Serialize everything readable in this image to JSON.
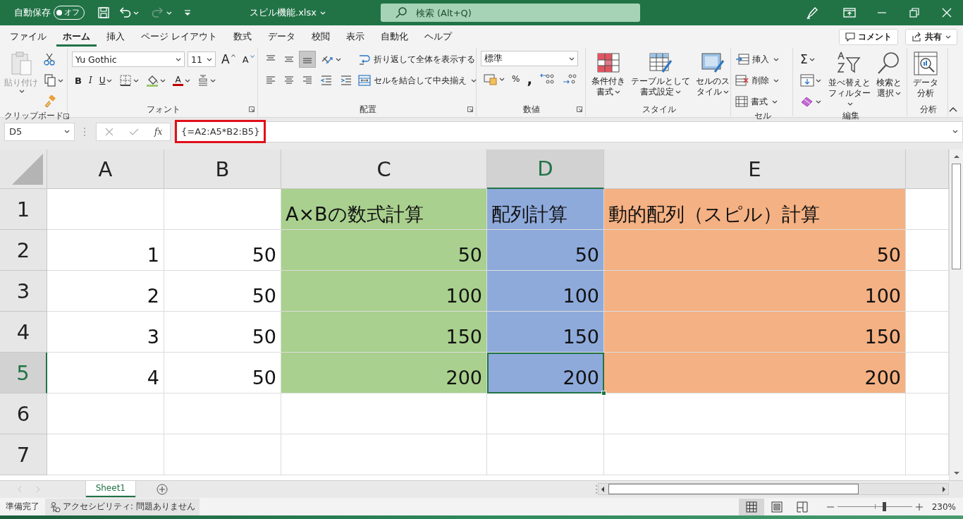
{
  "title_bar": {
    "autosave_label": "自動保存",
    "autosave_toggle": {
      "label": "オフ",
      "on": false
    },
    "redo_disabled": true,
    "filename": "スピル機能.xlsx",
    "search_placeholder": "検索 (Alt+Q)"
  },
  "menu_tabs": [
    {
      "label": "ファイル",
      "selected": false
    },
    {
      "label": "ホーム",
      "selected": true
    },
    {
      "label": "挿入",
      "selected": false
    },
    {
      "label": "ページ レイアウト",
      "selected": false
    },
    {
      "label": "数式",
      "selected": false
    },
    {
      "label": "データ",
      "selected": false
    },
    {
      "label": "校閲",
      "selected": false
    },
    {
      "label": "表示",
      "selected": false
    },
    {
      "label": "自動化",
      "selected": false
    },
    {
      "label": "ヘルプ",
      "selected": false
    }
  ],
  "comment_button": "コメント",
  "share_button": "共有",
  "ribbon": [
    {
      "label": "クリップボード",
      "launcher": true,
      "columns": [
        [
          {
            "kind": "paste",
            "label": "貼り付け",
            "disabled": true,
            "menu": true
          }
        ],
        [
          {
            "kind": "cut"
          },
          {
            "kind": "copy",
            "menu": true
          },
          {
            "kind": "painter"
          }
        ]
      ]
    },
    {
      "label": "フォント",
      "launcher": true,
      "columns": [
        [
          {
            "kind": "row",
            "items": [
              {
                "kind": "font-select",
                "value": "Yu Gothic"
              },
              {
                "kind": "size-select",
                "value": "11"
              },
              {
                "kind": "grow",
                "glyph": "A"
              },
              {
                "kind": "shrink",
                "glyph": "A"
              }
            ]
          },
          {
            "kind": "row",
            "items": [
              {
                "kind": "bold",
                "glyph": "B"
              },
              {
                "kind": "italic",
                "glyph": "I"
              },
              {
                "kind": "underline",
                "glyph": "U",
                "menu": true
              },
              {
                "kind": "borders",
                "menu": true
              },
              {
                "kind": "fill",
                "menu": true
              },
              {
                "kind": "fontcolor",
                "glyph": "A",
                "menu": true
              },
              {
                "kind": "phonetic",
                "menu": true
              }
            ]
          }
        ]
      ]
    },
    {
      "label": "配置",
      "launcher": true,
      "columns": [
        [
          {
            "kind": "row",
            "items": [
              {
                "kind": "align-top",
                "selected": false
              },
              {
                "kind": "align-middle",
                "selected": false
              },
              {
                "kind": "align-bottom",
                "selected": true
              },
              {
                "kind": "orientation",
                "menu": true
              }
            ]
          },
          {
            "kind": "row",
            "items": [
              {
                "kind": "align-left"
              },
              {
                "kind": "align-center"
              },
              {
                "kind": "align-right"
              },
              {
                "kind": "outdent"
              },
              {
                "kind": "indent"
              }
            ]
          }
        ],
        [
          {
            "kind": "wrap",
            "label": "折り返して全体を表示する"
          },
          {
            "kind": "merge",
            "label": "セルを結合して中央揃え",
            "menu": true
          }
        ]
      ]
    },
    {
      "label": "数値",
      "launcher": true,
      "columns": [
        [
          {
            "kind": "row",
            "items": [
              {
                "kind": "number-select",
                "value": "標準"
              }
            ]
          },
          {
            "kind": "row",
            "items": [
              {
                "kind": "accounting",
                "menu": true
              },
              {
                "kind": "percent",
                "glyph": "%"
              },
              {
                "kind": "comma",
                "glyph": ","
              },
              {
                "kind": "inc-decimal"
              },
              {
                "kind": "dec-decimal"
              }
            ]
          }
        ]
      ]
    },
    {
      "label": "スタイル",
      "columns": [
        [
          {
            "kind": "conditional",
            "label": "条件付き書式",
            "menu": true
          }
        ],
        [
          {
            "kind": "table-format",
            "label": "テーブルとして書式設定",
            "menu": true
          }
        ],
        [
          {
            "kind": "cell-styles",
            "label": "セルのスタイル",
            "menu": true
          }
        ]
      ]
    },
    {
      "label": "セル",
      "columns": [
        [
          {
            "kind": "insert",
            "label": "挿入",
            "menu": true
          },
          {
            "kind": "delete",
            "label": "削除",
            "menu": true
          },
          {
            "kind": "format",
            "label": "書式",
            "menu": true
          }
        ]
      ]
    },
    {
      "label": "編集",
      "columns": [
        [
          {
            "kind": "autosum",
            "glyph": "Σ",
            "menu": true
          },
          {
            "kind": "filldown",
            "menu": true
          },
          {
            "kind": "clear",
            "menu": true
          }
        ],
        [
          {
            "kind": "sort",
            "label": "並べ替えとフィルター",
            "menu": true
          }
        ],
        [
          {
            "kind": "find",
            "label": "検索と選択",
            "menu": true
          }
        ]
      ]
    },
    {
      "label": "分析",
      "columns": [
        [
          {
            "kind": "analyze",
            "label": "データ分析"
          }
        ]
      ]
    }
  ],
  "formula_bar": {
    "name_box": "D5",
    "fx": "fx",
    "formula": "{=A2:A5*B2:B5}",
    "highlighted": true
  },
  "columns": [
    {
      "label": "A",
      "selected": false
    },
    {
      "label": "B",
      "selected": false
    },
    {
      "label": "C",
      "selected": false
    },
    {
      "label": "D",
      "selected": true
    },
    {
      "label": "E",
      "selected": false
    }
  ],
  "rows": [
    {
      "label": "1",
      "selected": false,
      "cells": [
        {
          "selected": false
        },
        {
          "selected": false
        },
        {
          "kind": "text",
          "text": "A×Bの数式計算",
          "color": "#a9d08e",
          "selected": false
        },
        {
          "kind": "text",
          "text": "配列計算",
          "color": "#8eaadb",
          "selected": false
        },
        {
          "kind": "text",
          "text": "動的配列（スピル）計算",
          "color": "#f4b183",
          "selected": false
        }
      ]
    },
    {
      "label": "2",
      "selected": false,
      "cells": [
        {
          "kind": "number",
          "text": "1",
          "selected": false
        },
        {
          "kind": "number",
          "text": "50",
          "selected": false
        },
        {
          "kind": "number",
          "text": "50",
          "color": "#a9d08e",
          "selected": false
        },
        {
          "kind": "number",
          "text": "50",
          "color": "#8eaadb",
          "selected": false
        },
        {
          "kind": "number",
          "text": "50",
          "color": "#f4b183",
          "selected": false
        }
      ]
    },
    {
      "label": "3",
      "selected": false,
      "cells": [
        {
          "kind": "number",
          "text": "2",
          "selected": false
        },
        {
          "kind": "number",
          "text": "50",
          "selected": false
        },
        {
          "kind": "number",
          "text": "100",
          "color": "#a9d08e",
          "selected": false
        },
        {
          "kind": "number",
          "text": "100",
          "color": "#8eaadb",
          "selected": false
        },
        {
          "kind": "number",
          "text": "100",
          "color": "#f4b183",
          "selected": false
        }
      ]
    },
    {
      "label": "4",
      "selected": false,
      "cells": [
        {
          "kind": "number",
          "text": "3",
          "selected": false
        },
        {
          "kind": "number",
          "text": "50",
          "selected": false
        },
        {
          "kind": "number",
          "text": "150",
          "color": "#a9d08e",
          "selected": false
        },
        {
          "kind": "number",
          "text": "150",
          "color": "#8eaadb",
          "selected": false
        },
        {
          "kind": "number",
          "text": "150",
          "color": "#f4b183",
          "selected": false
        }
      ]
    },
    {
      "label": "5",
      "selected": true,
      "cells": [
        {
          "kind": "number",
          "text": "4",
          "selected": false
        },
        {
          "kind": "number",
          "text": "50",
          "selected": false
        },
        {
          "kind": "number",
          "text": "200",
          "color": "#a9d08e",
          "selected": false
        },
        {
          "kind": "number",
          "text": "200",
          "color": "#8eaadb",
          "selected": true
        },
        {
          "kind": "number",
          "text": "200",
          "color": "#f4b183",
          "selected": false
        }
      ]
    },
    {
      "label": "6",
      "selected": false,
      "cells": [
        {
          "selected": false
        },
        {
          "selected": false
        },
        {
          "selected": false
        },
        {
          "selected": false
        },
        {
          "selected": false
        }
      ]
    },
    {
      "label": "7",
      "selected": false,
      "cells": [
        {
          "selected": false
        },
        {
          "selected": false
        },
        {
          "selected": false
        },
        {
          "selected": false
        },
        {
          "selected": false
        }
      ]
    }
  ],
  "sheet_tabs": [
    {
      "label": "Sheet1",
      "selected": true
    }
  ],
  "status_bar": {
    "status": "準備完了",
    "accessibility": "アクセシビリティ: 問題ありません",
    "views": [
      {
        "kind": "normal",
        "selected": true
      },
      {
        "kind": "page-layout",
        "selected": false
      },
      {
        "kind": "page-break",
        "selected": false
      }
    ],
    "zoom": {
      "level": 0.63
    },
    "zoom_label": "230%"
  }
}
